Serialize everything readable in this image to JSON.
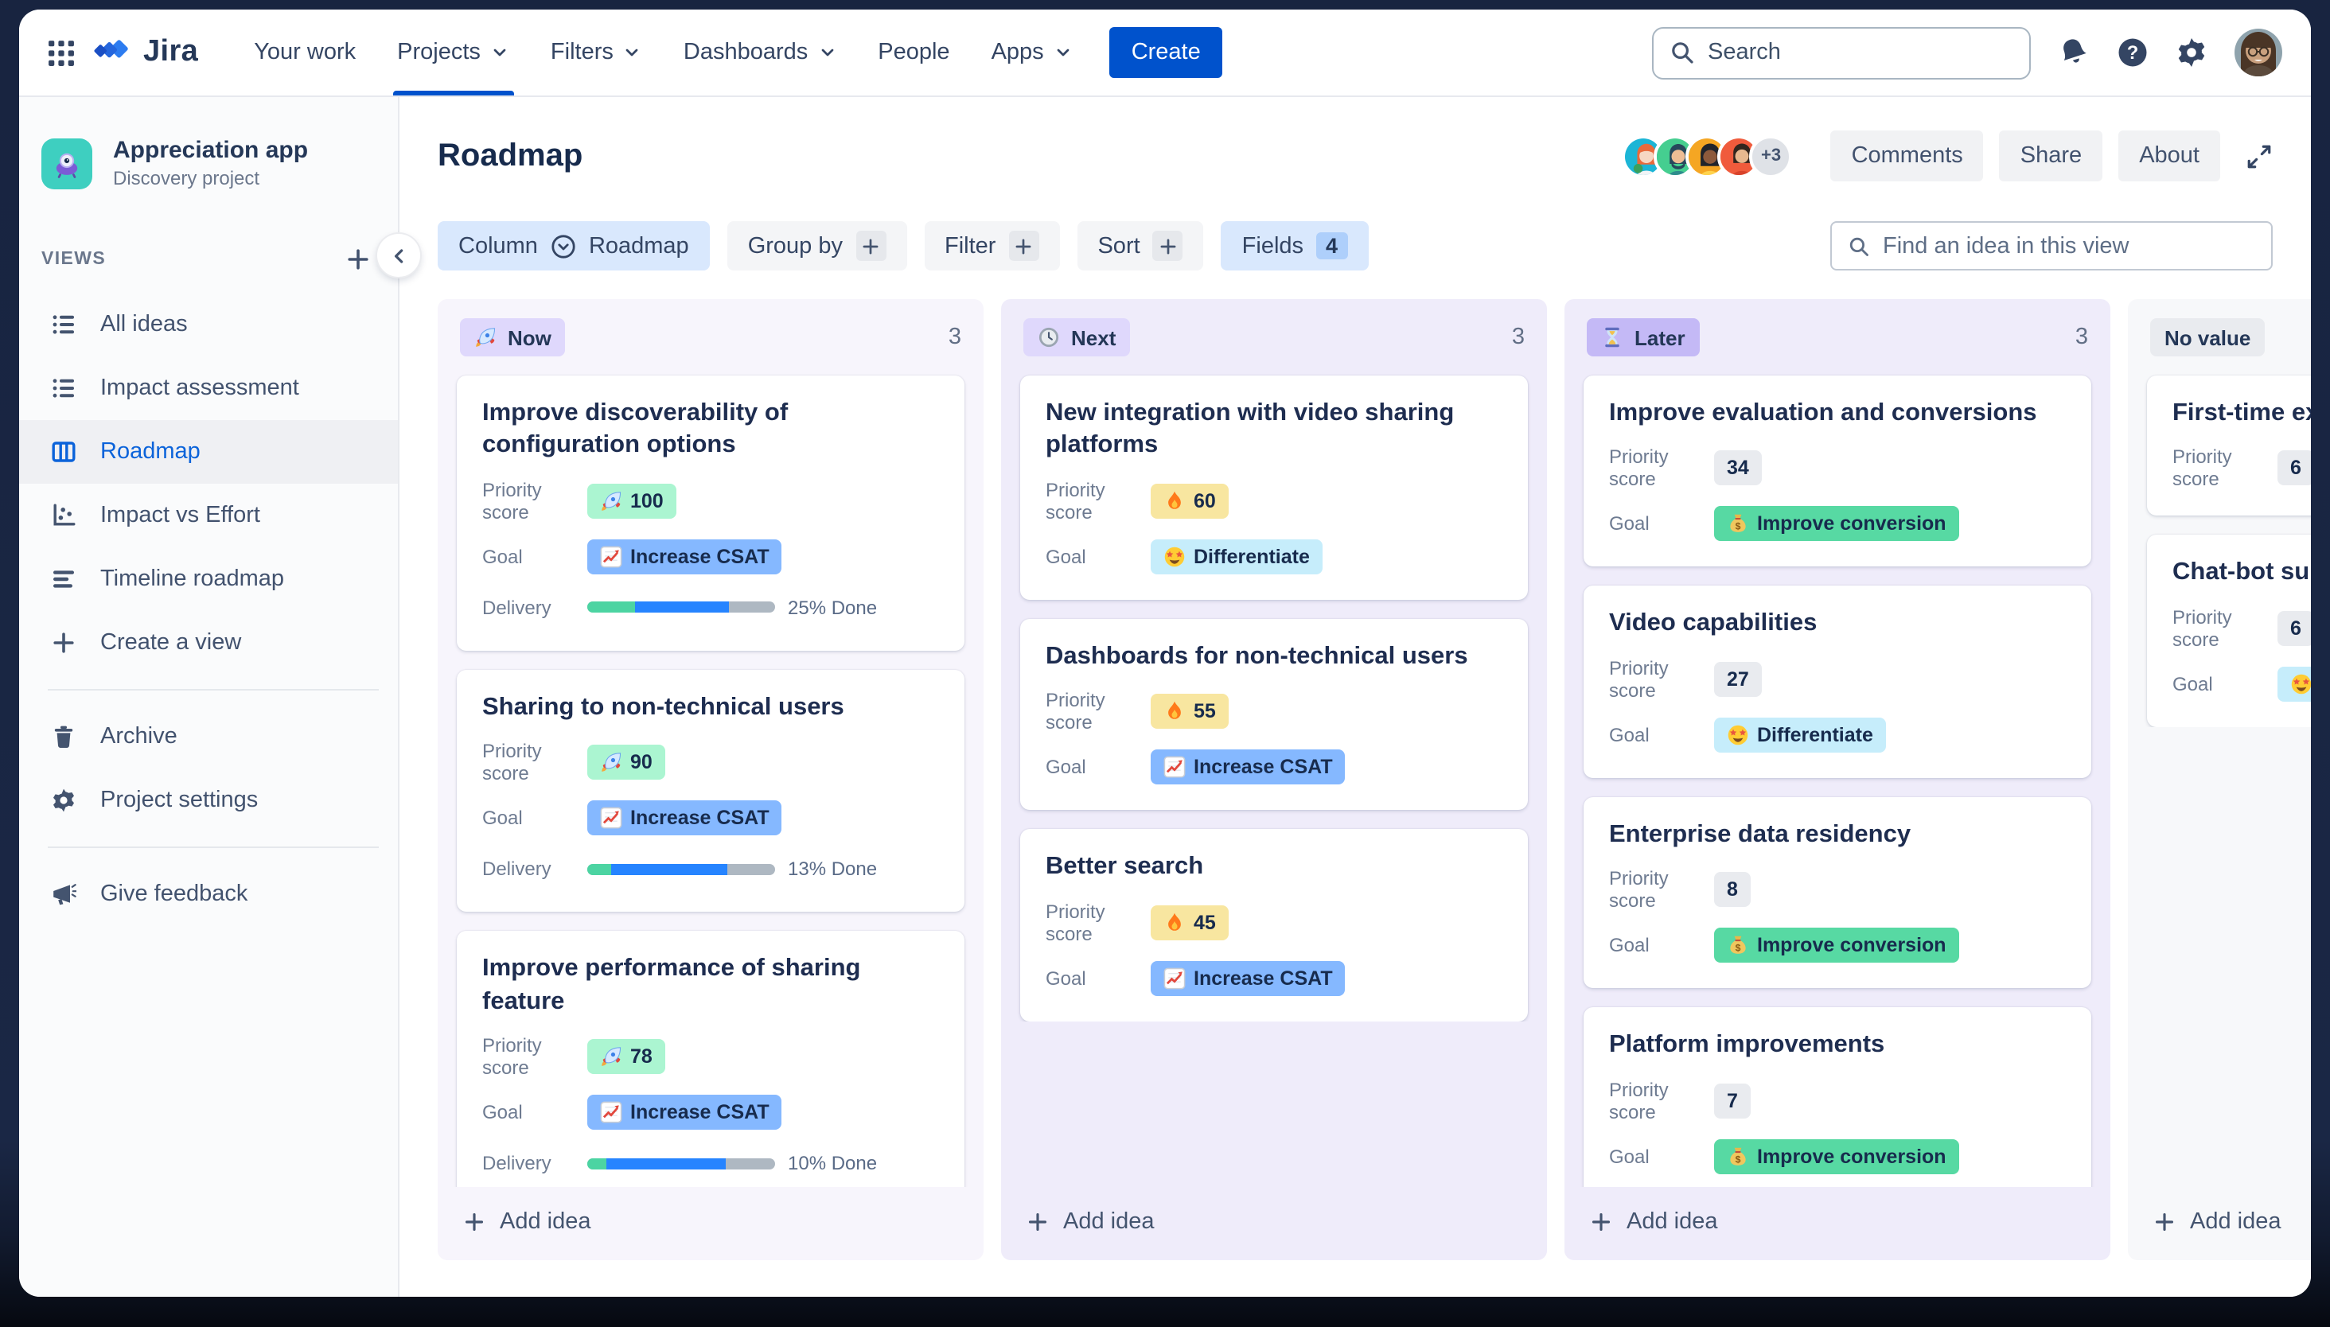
{
  "colors": {
    "brand_blue": "#0052CC",
    "active_link_blue": "#0B63DA",
    "frame_navy": "#182440",
    "pill_green": "#ABF5D1",
    "pill_yellow": "#F8E6A0",
    "pill_blue": "#85B8FF",
    "pill_cyan": "#C6EDFB",
    "pill_green_strong": "#57D9A3",
    "pill_gray": "#E9EBEF",
    "badge_purple": "#DFD8FC",
    "badge_purple_strong": "#C4B9F6",
    "column_lavender": "#EFECFA",
    "progress_green": "#4CD4A2",
    "progress_blue": "#2684FF",
    "progress_gray": "#AEB8C2"
  },
  "topnav": {
    "brand": "Jira",
    "search_placeholder": "Search",
    "create_label": "Create",
    "items": [
      {
        "label": "Your work"
      },
      {
        "label": "Projects"
      },
      {
        "label": "Filters"
      },
      {
        "label": "Dashboards"
      },
      {
        "label": "People"
      },
      {
        "label": "Apps"
      }
    ]
  },
  "sidebar": {
    "project_name": "Appreciation app",
    "project_type": "Discovery project",
    "views_label": "VIEWS",
    "items": [
      {
        "label": "All ideas"
      },
      {
        "label": "Impact assessment"
      },
      {
        "label": "Roadmap"
      },
      {
        "label": "Impact vs Effort"
      },
      {
        "label": "Timeline roadmap"
      },
      {
        "label": "Create a view"
      }
    ],
    "archive_label": "Archive",
    "settings_label": "Project settings",
    "feedback_label": "Give feedback"
  },
  "header": {
    "title": "Roadmap",
    "avatars_overflow": "+3",
    "comments_label": "Comments",
    "share_label": "Share",
    "about_label": "About"
  },
  "toolbar": {
    "column_label": "Column",
    "column_value": "Roadmap",
    "group_by_label": "Group by",
    "filter_label": "Filter",
    "sort_label": "Sort",
    "fields_label": "Fields",
    "fields_count": "4",
    "find_placeholder": "Find an idea in this view"
  },
  "labels": {
    "priority_score": "Priority score",
    "goal": "Goal",
    "delivery": "Delivery",
    "add_idea": "Add idea"
  },
  "board": {
    "columns": [
      {
        "label": "Now",
        "count": "3",
        "cards": [
          {
            "title": "Improve discoverability of configuration options",
            "priority": "100",
            "goal": "Increase CSAT",
            "delivery_done": "25% Done",
            "delivery_green": 25,
            "delivery_blue": 50
          },
          {
            "title": "Sharing to non-technical users",
            "priority": "90",
            "goal": "Increase CSAT",
            "delivery_done": "13% Done",
            "delivery_green": 13,
            "delivery_blue": 62
          },
          {
            "title": "Improve performance of sharing feature",
            "priority": "78",
            "goal": "Increase CSAT",
            "delivery_done": "10% Done",
            "delivery_green": 10,
            "delivery_blue": 64
          }
        ]
      },
      {
        "label": "Next",
        "count": "3",
        "cards": [
          {
            "title": "New integration with video sharing platforms",
            "priority": "60",
            "goal": "Differentiate"
          },
          {
            "title": "Dashboards for non-technical users",
            "priority": "55",
            "goal": "Increase CSAT"
          },
          {
            "title": "Better search",
            "priority": "45",
            "goal": "Increase CSAT"
          }
        ]
      },
      {
        "label": "Later",
        "count": "3",
        "cards": [
          {
            "title": "Improve evaluation and conversions",
            "priority": "34",
            "goal": "Improve conversion"
          },
          {
            "title": "Video capabilities",
            "priority": "27",
            "goal": "Differentiate"
          },
          {
            "title": "Enterprise data residency",
            "priority": "8",
            "goal": "Improve conversion"
          },
          {
            "title": "Platform improvements",
            "priority": "7",
            "goal": "Improve conversion"
          }
        ]
      },
      {
        "label": "No value",
        "cards": [
          {
            "title": "First-time ex",
            "priority": "6"
          },
          {
            "title": "Chat-bot sup",
            "priority": "6"
          }
        ]
      }
    ]
  }
}
